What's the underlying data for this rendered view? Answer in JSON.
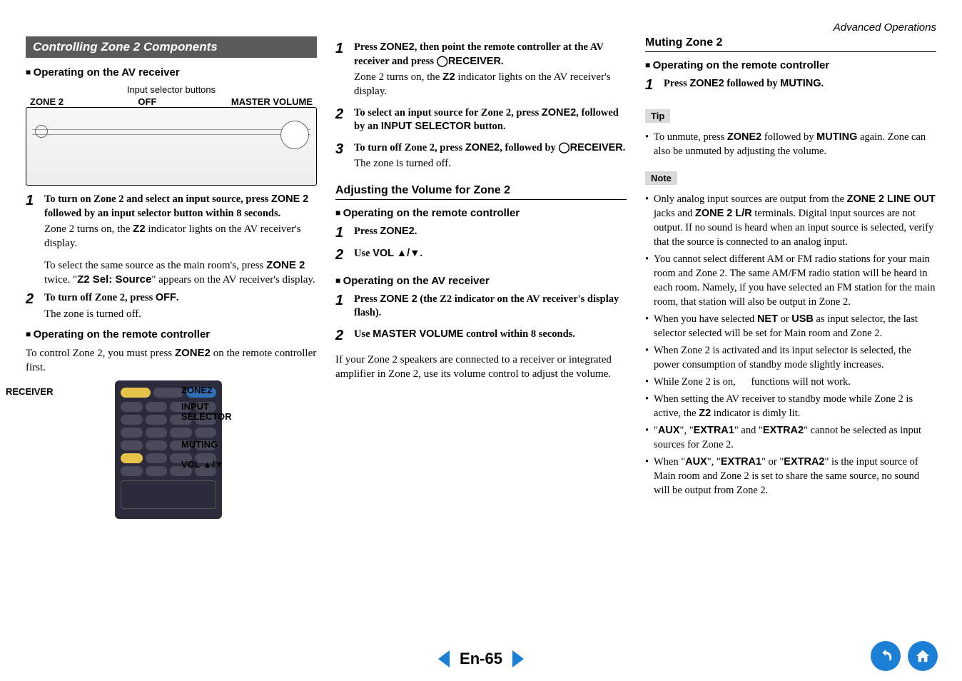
{
  "header": {
    "breadcrumb": "Advanced Operations"
  },
  "col1": {
    "bar": "Controlling Zone 2 Components",
    "sub1": "Operating on the AV receiver",
    "diagram": {
      "top": "Input selector buttons",
      "left": "ZONE 2",
      "mid": "OFF",
      "right": "MASTER VOLUME"
    },
    "steps_a": [
      {
        "n": "1",
        "lead_html": "To turn on Zone 2 and select an input source, press <strong class='sans'>ZONE 2</strong> followed by an input selector button within 8 seconds.",
        "body_html": "Zone 2 turns on, the <strong class='sans'>Z2</strong> indicator lights on the AV receiver's display."
      }
    ],
    "para1_html": "To select the same source as the main room's, press <strong class='sans'>ZONE 2</strong> twice. \"<strong class='sans'>Z2 Sel: Source</strong>\" appears on the AV receiver's display.",
    "steps_b": [
      {
        "n": "2",
        "lead_html": "To turn off Zone 2, press <strong class='sans'>OFF</strong>.",
        "body_html": "The zone is turned off."
      }
    ],
    "sub2": "Operating on the remote controller",
    "para2_html": "To control Zone 2, you must press <strong class='sans'>ZONE2</strong> on the remote controller first.",
    "remote_callouts": {
      "receiver": "RECEIVER",
      "zone2": "ZONE2",
      "input_sel": "INPUT SELECTOR",
      "muting": "MUTING",
      "vol": "VOL ▲/▼"
    }
  },
  "col2": {
    "steps": [
      {
        "n": "1",
        "lead_html": "Press <strong class='sans'>ZONE2</strong>, then point the remote controller at the AV receiver and press <strong class='sans'>◯RECEIVER</strong>.",
        "body_html": "Zone 2 turns on, the <strong class='sans'>Z2</strong> indicator lights on the AV receiver's display."
      },
      {
        "n": "2",
        "lead_html": "To select an input source for Zone 2, press <strong class='sans'>ZONE2</strong>, followed by an <strong class='sans'>INPUT SELECTOR</strong> button.",
        "body_html": ""
      },
      {
        "n": "3",
        "lead_html": "To turn off Zone 2, press <strong class='sans'>ZONE2</strong>, followed by <strong class='sans'>◯RECEIVER</strong>.",
        "body_html": "The zone is turned off."
      }
    ],
    "title1": "Adjusting the Volume for Zone 2",
    "sub1": "Operating on the remote controller",
    "steps_r": [
      {
        "n": "1",
        "lead_html": "Press <strong class='sans'>ZONE2</strong>.",
        "body_html": ""
      },
      {
        "n": "2",
        "lead_html": "Use <strong class='sans'>VOL ▲/▼</strong>.",
        "body_html": ""
      }
    ],
    "sub2": "Operating on the AV receiver",
    "steps_av": [
      {
        "n": "1",
        "lead_html": "Press <strong class='sans'>ZONE 2</strong> (the Z2 indicator on the AV receiver's display flash).",
        "body_html": ""
      },
      {
        "n": "2",
        "lead_html": "Use <strong class='sans'>MASTER VOLUME</strong> control within 8 seconds.",
        "body_html": ""
      }
    ],
    "para_ext": "If your Zone 2 speakers are connected to a receiver or integrated amplifier in Zone 2, use its volume control to adjust the volume."
  },
  "col3": {
    "title": "Muting Zone 2",
    "sub": "Operating on the remote controller",
    "steps": [
      {
        "n": "1",
        "lead_html": "Press <strong class='sans'>ZONE2</strong> followed by <strong class='sans'>MUTING</strong>.",
        "body_html": ""
      }
    ],
    "tip_label": "Tip",
    "tip_items": [
      "To unmute, press <strong class='sans'>ZONE2</strong> followed by <strong class='sans'>MUTING</strong> again. Zone can also be unmuted by adjusting the volume."
    ],
    "note_label": "Note",
    "note_items": [
      "Only analog input sources are output from the <strong class='sans'>ZONE 2 LINE OUT</strong> jacks and <strong class='sans'>ZONE 2 L/R</strong> terminals. Digital input sources are not output. If no sound is heard when an input source is selected, verify that the source is connected to an analog input.",
      "You cannot select different AM or FM radio stations for your main room and Zone 2. The same AM/FM radio station will be heard in each room. Namely, if you have selected an FM station for the main room, that station will also be output in Zone 2.",
      "When you have selected <strong class='sans'>NET</strong> or <strong class='sans'>USB</strong> as input selector, the last selector selected will be set for Main room and Zone 2.",
      "When Zone 2 is activated and its input selector is selected, the power consumption of standby mode slightly increases.",
      "While Zone 2 is on, &nbsp;&nbsp;&nbsp;&nbsp; functions will not work.",
      "When setting the AV receiver to standby mode while Zone 2 is active, the <strong class='sans'>Z2</strong> indicator is dimly lit.",
      "\"<strong class='sans'>AUX</strong>\", \"<strong class='sans'>EXTRA1</strong>\" and \"<strong class='sans'>EXTRA2</strong>\" cannot be selected as input sources for Zone 2.",
      "When \"<strong class='sans'>AUX</strong>\", \"<strong class='sans'>EXTRA1</strong>\" or \"<strong class='sans'>EXTRA2</strong>\" is the input source of Main room and Zone 2 is set to share the same source, no sound will be output from Zone 2."
    ]
  },
  "footer": {
    "page": "En-65"
  }
}
